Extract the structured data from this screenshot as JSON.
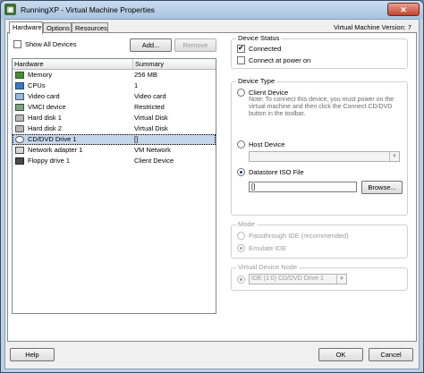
{
  "window": {
    "title": "RunningXP - Virtual Machine Properties",
    "vm_version": "Virtual Machine Version: 7"
  },
  "tabs": [
    {
      "label": "Hardware",
      "active": true
    },
    {
      "label": "Options",
      "active": false
    },
    {
      "label": "Resources",
      "active": false
    }
  ],
  "hardware": {
    "show_all_devices_label": "Show All Devices",
    "add_label": "Add...",
    "remove_label": "Remove",
    "columns": {
      "hardware": "Hardware",
      "summary": "Summary"
    },
    "rows": [
      {
        "name": "Memory",
        "summary": "256 MB",
        "icon": "memory-icon"
      },
      {
        "name": "CPUs",
        "summary": "1",
        "icon": "cpu-icon"
      },
      {
        "name": "Video card",
        "summary": "Video card",
        "icon": "video-card-icon"
      },
      {
        "name": "VMCI device",
        "summary": "Restricted",
        "icon": "vmci-icon"
      },
      {
        "name": "Hard disk 1",
        "summary": "Virtual Disk",
        "icon": "hard-disk-icon"
      },
      {
        "name": "Hard disk 2",
        "summary": "Virtual Disk",
        "icon": "hard-disk-icon"
      },
      {
        "name": "CD/DVD Drive 1",
        "summary": "[]",
        "icon": "cd-dvd-icon",
        "selected": true
      },
      {
        "name": "Network adapter 1",
        "summary": "VM Network",
        "icon": "network-adapter-icon"
      },
      {
        "name": "Floppy drive 1",
        "summary": "Client Device",
        "icon": "floppy-icon"
      }
    ]
  },
  "device_status": {
    "title": "Device Status",
    "connected_label": "Connected",
    "connected_checked": true,
    "connect_power_on_label": "Connect at power on",
    "connect_power_on_checked": false
  },
  "device_type": {
    "title": "Device Type",
    "client_device_label": "Client Device",
    "client_note": "Note: To connect this device, you must power on the virtual machine and then click the Connect CD/DVD button in the toolbar.",
    "host_device_label": "Host Device",
    "host_device_value": "",
    "datastore_iso_label": "Datastore ISO File",
    "datastore_iso_value": "[]",
    "browse_label": "Browse..."
  },
  "mode": {
    "title": "Mode",
    "passthrough_label": "Passthrough IDE (recommended)",
    "emulate_label": "Emulate IDE"
  },
  "virtual_device_node": {
    "title": "Virtual Device Node",
    "value": "IDE (1:0) CD/DVD Drive 1"
  },
  "footer": {
    "help_label": "Help",
    "ok_label": "OK",
    "cancel_label": "Cancel"
  }
}
